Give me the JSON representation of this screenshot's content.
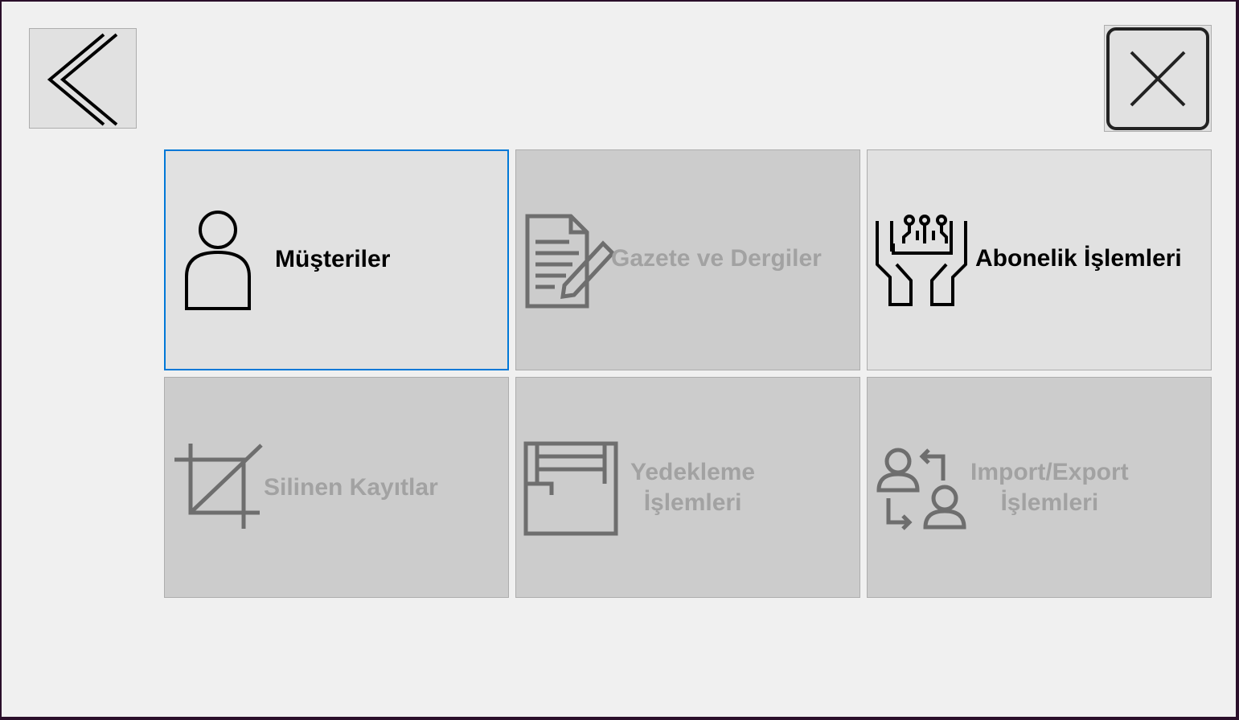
{
  "nav": {
    "back_icon": "double-chevron-left-icon",
    "close_icon": "close-x-icon"
  },
  "tiles": [
    {
      "label": "Müşteriler",
      "icon": "person-icon",
      "enabled": true,
      "focused": true
    },
    {
      "label": "Gazete ve Dergiler",
      "icon": "document-edit-icon",
      "enabled": false
    },
    {
      "label": "Abonelik İşlemleri",
      "icon": "hands-circuit-icon",
      "enabled": true
    },
    {
      "label": "Silinen Kayıtlar",
      "icon": "crop-icon",
      "enabled": false
    },
    {
      "label": "Yedekleme\nİşlemleri",
      "icon": "inbox-tray-icon",
      "enabled": false
    },
    {
      "label": "Import/Export\nİşlemleri",
      "icon": "user-exchange-icon",
      "enabled": false
    }
  ],
  "colors": {
    "focus_border": "#0078d7",
    "enabled_text": "#000000",
    "disabled_text": "#a2a2a2",
    "disabled_icon": "#6e6e6e"
  }
}
